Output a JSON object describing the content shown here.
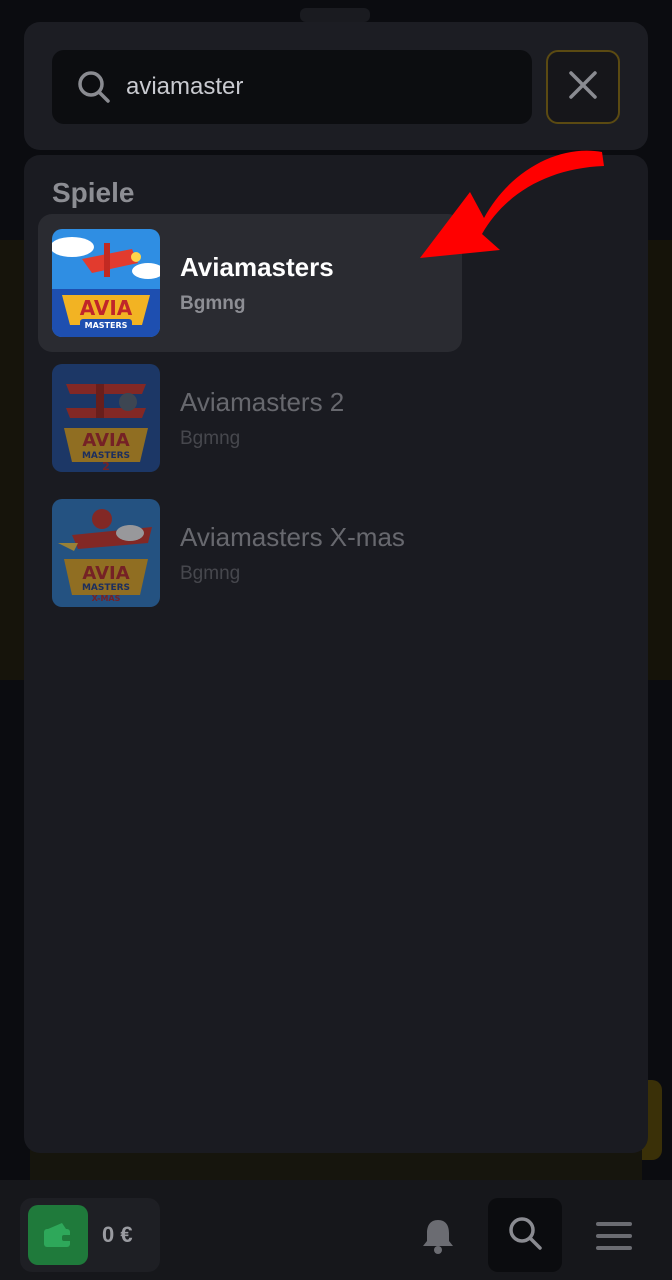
{
  "search": {
    "query": "aviamaster",
    "icon": "search-icon",
    "close_icon": "close-icon"
  },
  "results": {
    "section_title": "Spiele",
    "games": [
      {
        "name": "Aviamasters",
        "provider": "Bgmng",
        "highlighted": true
      },
      {
        "name": "Aviamasters 2",
        "provider": "Bgmng",
        "highlighted": false
      },
      {
        "name": "Aviamasters X-mas",
        "provider": "Bgmng",
        "highlighted": false
      }
    ]
  },
  "bottom_bar": {
    "balance": "0 €",
    "icons": [
      "wallet-icon",
      "bell-icon",
      "search-icon",
      "menu-icon"
    ]
  },
  "colors": {
    "accent_border": "#5b4a12",
    "wallet_green": "#1f7a3b",
    "arrow_red": "#ff0000"
  }
}
